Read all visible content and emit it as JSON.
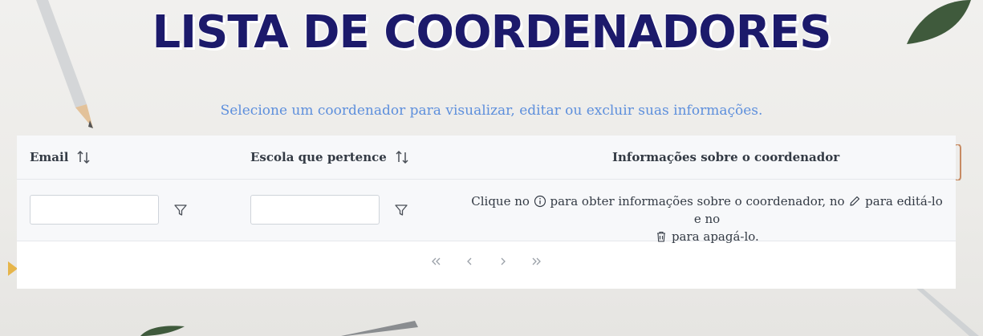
{
  "page": {
    "title": "LISTA DE COORDENADORES",
    "subtitle": "Selecione um coordenador para visualizar, editar ou excluir suas informações."
  },
  "table": {
    "columns": [
      {
        "label": "Email",
        "sortable": true
      },
      {
        "label": "Escola que pertence",
        "sortable": true
      },
      {
        "label": "Informações sobre o coordenador",
        "sortable": false
      }
    ],
    "filters": {
      "email_value": "",
      "escola_value": ""
    },
    "info": {
      "part1": "Clique no",
      "part2": "para obter informações sobre o coordenador, no",
      "part3": "para editá-lo e no",
      "part4": "para apagá-lo."
    },
    "icons": [
      "sort-icon",
      "filter-icon",
      "info-icon",
      "pencil-icon",
      "trash-icon"
    ]
  },
  "pagination": {
    "icons": [
      "first-page-icon",
      "prev-page-icon",
      "next-page-icon",
      "last-page-icon"
    ]
  },
  "colors": {
    "title": "#1c1a6b",
    "subtitle": "#5d8fdc",
    "text": "#333a44"
  }
}
